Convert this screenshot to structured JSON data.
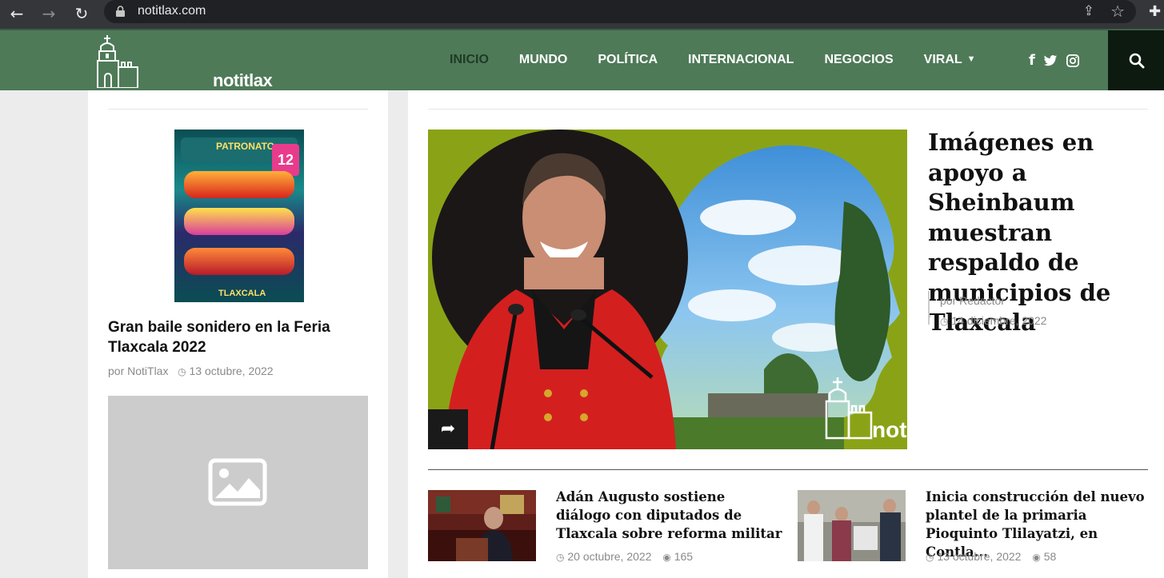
{
  "browser": {
    "url": "notitlax.com",
    "back_icon": "←",
    "forward_icon": "→",
    "reload_icon": "↻",
    "share_icon": "⇪",
    "star_icon": "☆",
    "extensions_icon": "✚"
  },
  "site": {
    "logo_text": "notitlax",
    "brand_color": "#4e7a58",
    "nav": [
      {
        "label": "INICIO",
        "active": true
      },
      {
        "label": "MUNDO"
      },
      {
        "label": "POLÍTICA"
      },
      {
        "label": "INTERNACIONAL"
      },
      {
        "label": "NEGOCIOS"
      },
      {
        "label": "VIRAL",
        "has_dropdown": true
      }
    ],
    "social": {
      "facebook": "f",
      "twitter": "t",
      "instagram": "◎"
    }
  },
  "sidebar": {
    "poster": {
      "title": "PATRONATO",
      "footer": "TLAXCALA",
      "date": "12"
    },
    "article_title": "Gran baile sonidero en la Feria Tlaxcala 2022",
    "author": "por NotiTlax",
    "date": "13 octubre, 2022"
  },
  "featured": {
    "title": "Imágenes en apoyo a Sheinbaum muestran respaldo de municipios de Tlaxcala",
    "author": "por Redactor",
    "date": "14 diciembre, 2022",
    "watermark": "notit"
  },
  "cards": [
    {
      "title": "Adán Augusto sostiene diálogo con diputados de Tlaxcala sobre reforma militar",
      "date": "20 octubre, 2022",
      "views": "165"
    },
    {
      "title": "Inicia construcción del nuevo plantel de la primaria Pioquinto Tlilayatzi, en Contla...",
      "date": "13 octubre, 2022",
      "views": "58"
    }
  ]
}
